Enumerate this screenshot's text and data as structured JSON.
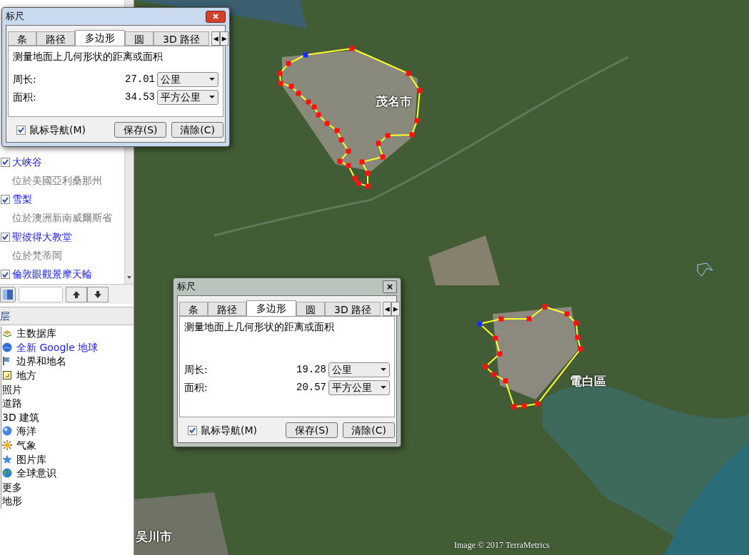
{
  "places": [
    {
      "title": "大峡谷",
      "subtitle": "位於美國亞利桑那州",
      "checked": true
    },
    {
      "title": "雪梨",
      "subtitle": "位於澳洲新南威爾斯省",
      "checked": true
    },
    {
      "title": "聖彼得大教堂",
      "subtitle": "位於梵蒂岡",
      "checked": true
    },
    {
      "title": "倫敦眼觀景摩天輪",
      "checked": true
    }
  ],
  "layers_header": "层",
  "layers": [
    {
      "label": "主数据库",
      "kind": "plain"
    },
    {
      "label": "全新 Google 地球",
      "kind": "link"
    },
    {
      "label": "边界和地名",
      "kind": "plain"
    },
    {
      "label": "地方",
      "kind": "plain"
    },
    {
      "label": "照片",
      "kind": "plain"
    },
    {
      "label": "道路",
      "kind": "plain"
    },
    {
      "label": "3D 建筑",
      "kind": "plain"
    },
    {
      "label": "海洋",
      "kind": "plain"
    },
    {
      "label": "气象",
      "kind": "plain"
    },
    {
      "label": "图片库",
      "kind": "plain"
    },
    {
      "label": "全球意识",
      "kind": "plain"
    },
    {
      "label": "更多",
      "kind": "plain"
    },
    {
      "label": "地形",
      "kind": "plain"
    }
  ],
  "map": {
    "labels": [
      "茂名市",
      "電白區",
      "吴川市"
    ],
    "attribution": "Image © 2017 TerraMetrics"
  },
  "rulers": [
    {
      "title": "标尺",
      "active": true,
      "tabs": [
        {
          "label": "条",
          "selected": false
        },
        {
          "label": "路径",
          "selected": false
        },
        {
          "label": "多边形",
          "selected": true
        },
        {
          "label": "圆",
          "selected": false
        },
        {
          "label": "3D 路径",
          "selected": false
        }
      ],
      "scroll_left": "◀",
      "scroll_right": "▶",
      "description": "测量地面上几何形状的距离或面积",
      "perimeter": {
        "label": "周长:",
        "value": "27.01",
        "unit": "公里"
      },
      "area": {
        "label": "面积:",
        "value": "34.53",
        "unit": "平方公里"
      },
      "mouse_nav": {
        "label": "鼠标导航(M)",
        "checked": true
      },
      "buttons": [
        "保存(S)",
        "清除(C)"
      ]
    },
    {
      "title": "标尺",
      "active": false,
      "tabs": [
        {
          "label": "条",
          "selected": false
        },
        {
          "label": "路径",
          "selected": false
        },
        {
          "label": "多边形",
          "selected": true
        },
        {
          "label": "圆",
          "selected": false
        },
        {
          "label": "3D 路径",
          "selected": false
        }
      ],
      "scroll_left": "◀",
      "scroll_right": "▶",
      "description": "测量地面上几何形状的距离或面积",
      "perimeter": {
        "label": "周长:",
        "value": "19.28",
        "unit": "公里"
      },
      "area": {
        "label": "面积:",
        "value": "20.57",
        "unit": "平方公里"
      },
      "mouse_nav": {
        "label": "鼠标导航(M)",
        "checked": true
      },
      "buttons": [
        "保存(S)",
        "清除(C)"
      ]
    }
  ]
}
